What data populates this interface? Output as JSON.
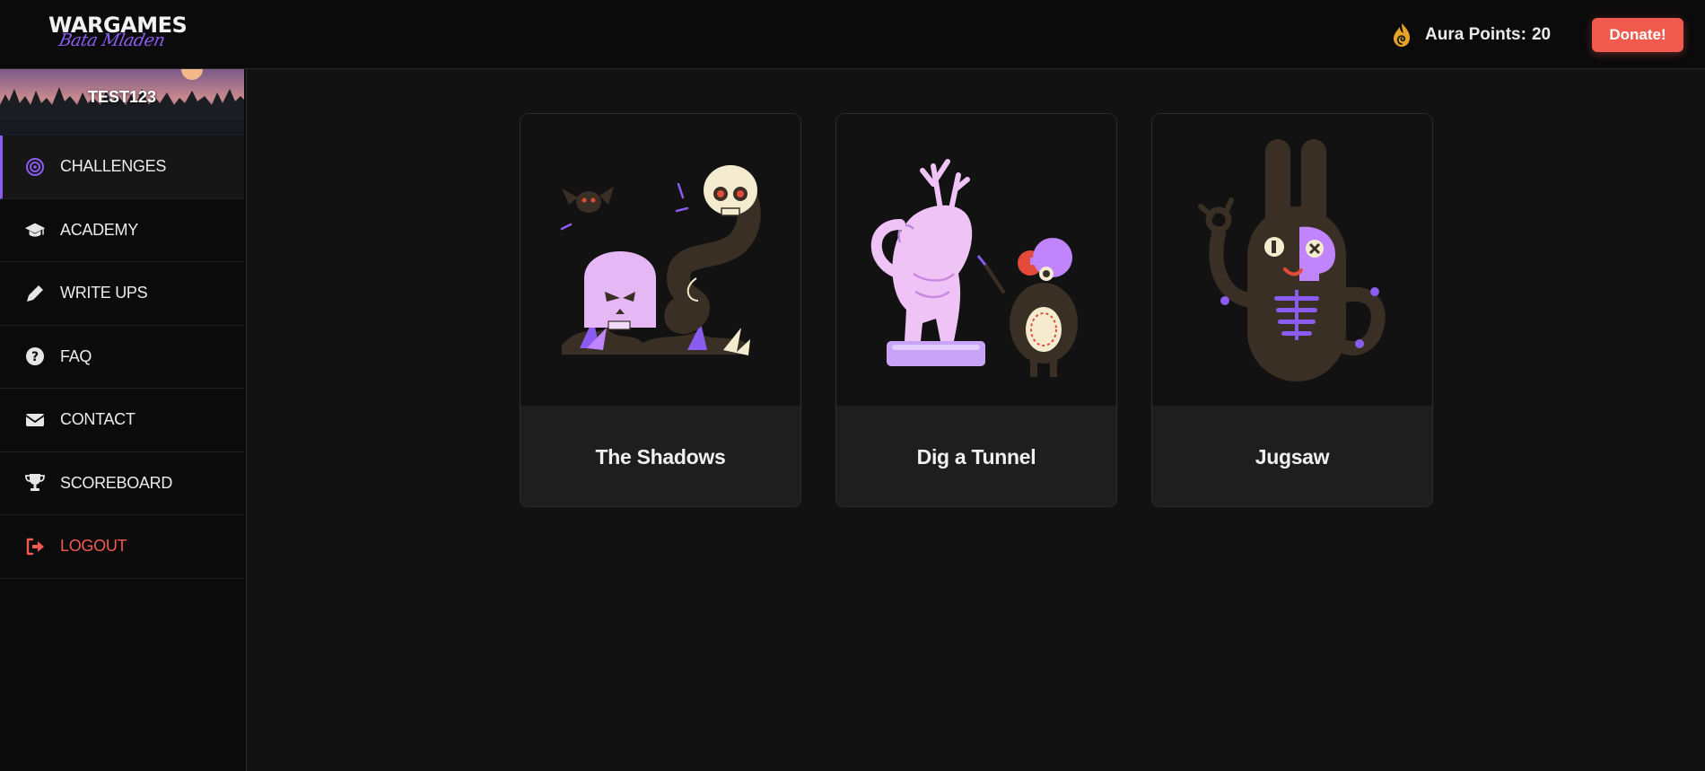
{
  "header": {
    "logo_main": "WARGAMES",
    "logo_sub": "Bata Mladen",
    "aura_label": "Aura Points:",
    "aura_value": "20",
    "donate_label": "Donate!"
  },
  "sidebar": {
    "username": "TEST123",
    "items": [
      {
        "label": "CHALLENGES",
        "icon": "target-icon",
        "active": true
      },
      {
        "label": "ACADEMY",
        "icon": "graduation-cap-icon"
      },
      {
        "label": "WRITE UPS",
        "icon": "pen-icon"
      },
      {
        "label": "FAQ",
        "icon": "question-circle-icon"
      },
      {
        "label": "CONTACT",
        "icon": "envelope-icon"
      },
      {
        "label": "SCOREBOARD",
        "icon": "trophy-icon"
      },
      {
        "label": "LOGOUT",
        "icon": "sign-out-icon"
      }
    ]
  },
  "challenges": [
    {
      "title": "The Shadows",
      "illustration": "ghost-skull-tombstone"
    },
    {
      "title": "Dig a Tunnel",
      "illustration": "statue-and-creature"
    },
    {
      "title": "Jugsaw",
      "illustration": "bunny-skeleton"
    }
  ],
  "colors": {
    "accent": "#8a5cf0",
    "donate": "#f05a4f",
    "logout": "#f25a52",
    "background": "#121212"
  }
}
